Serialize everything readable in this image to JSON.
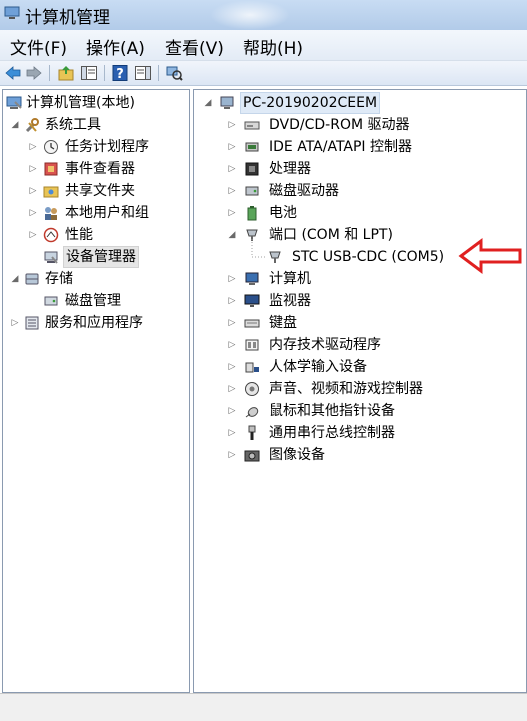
{
  "window": {
    "title": "计算机管理"
  },
  "menu": [
    {
      "label": "文件(F)"
    },
    {
      "label": "操作(A)"
    },
    {
      "label": "查看(V)"
    },
    {
      "label": "帮助(H)"
    }
  ],
  "toolbar": {
    "buttons": [
      "back-arrow-icon",
      "forward-arrow-icon",
      "up-folder-icon",
      "show-console-tree-icon",
      "help-icon",
      "action-pane-icon",
      "scan-hardware-icon"
    ]
  },
  "left_tree": [
    {
      "label": "计算机管理(本地)",
      "icon": "computer-management-icon",
      "expanded": true
    },
    {
      "label": "系统工具",
      "icon": "tools-icon",
      "expanded": true
    },
    {
      "label": "任务计划程序",
      "icon": "clock-icon"
    },
    {
      "label": "事件查看器",
      "icon": "event-viewer-icon"
    },
    {
      "label": "共享文件夹",
      "icon": "shared-folder-icon"
    },
    {
      "label": "本地用户和组",
      "icon": "users-icon"
    },
    {
      "label": "性能",
      "icon": "performance-icon"
    },
    {
      "label": "设备管理器",
      "icon": "device-manager-icon",
      "selected": true
    },
    {
      "label": "存储",
      "icon": "storage-icon",
      "expanded": true
    },
    {
      "label": "磁盘管理",
      "icon": "disk-management-icon"
    },
    {
      "label": "服务和应用程序",
      "icon": "services-icon"
    }
  ],
  "device_tree": {
    "root": "PC-20190202CEEM",
    "items": [
      {
        "label": "DVD/CD-ROM 驱动器",
        "icon": "dvd-drive-icon"
      },
      {
        "label": "IDE ATA/ATAPI 控制器",
        "icon": "ide-controller-icon"
      },
      {
        "label": "处理器",
        "icon": "processor-icon"
      },
      {
        "label": "磁盘驱动器",
        "icon": "disk-drive-icon"
      },
      {
        "label": "电池",
        "icon": "battery-icon"
      },
      {
        "label": "端口 (COM 和 LPT)",
        "icon": "port-icon",
        "expanded": true
      },
      {
        "label": "STC USB-CDC (COM5)",
        "icon": "port-device-icon",
        "child": true
      },
      {
        "label": "计算机",
        "icon": "computer-icon"
      },
      {
        "label": "监视器",
        "icon": "monitor-icon"
      },
      {
        "label": "键盘",
        "icon": "keyboard-icon"
      },
      {
        "label": "内存技术驱动程序",
        "icon": "memory-icon"
      },
      {
        "label": "人体学输入设备",
        "icon": "hid-icon"
      },
      {
        "label": "声音、视频和游戏控制器",
        "icon": "sound-icon"
      },
      {
        "label": "鼠标和其他指针设备",
        "icon": "mouse-icon"
      },
      {
        "label": "通用串行总线控制器",
        "icon": "usb-icon"
      },
      {
        "label": "图像设备",
        "icon": "camera-icon"
      }
    ]
  },
  "colors": {
    "annotation_arrow": "#e02020",
    "selection": "#e6e6e6"
  }
}
